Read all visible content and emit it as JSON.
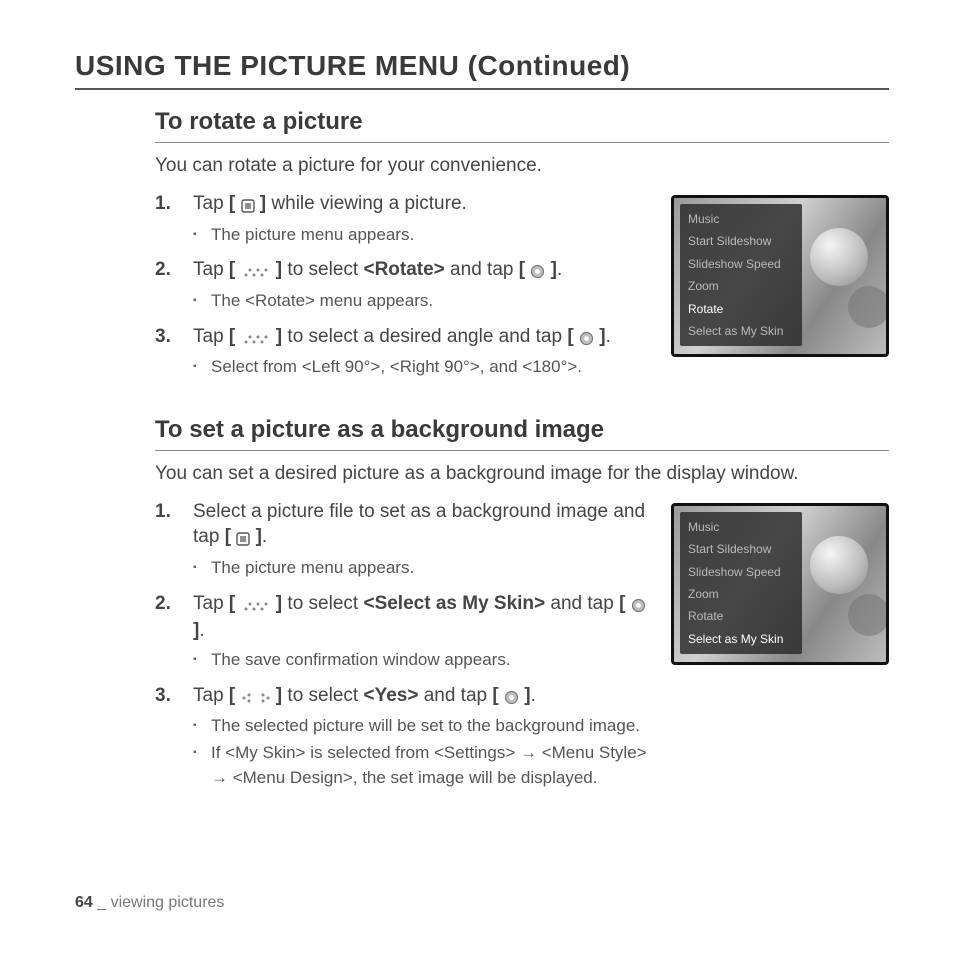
{
  "page": {
    "title": "USING THE PICTURE MENU (Continued)",
    "number": "64",
    "footer_sep": " _ ",
    "footer_label": "viewing pictures"
  },
  "icons": {
    "menu": "≣",
    "updown": "∴ ∵",
    "leftright": "∴  ∵",
    "select": "◉"
  },
  "section1": {
    "heading": "To rotate a picture",
    "intro": "You can rotate a picture for your convenience.",
    "steps": [
      {
        "pre": "Tap [ ",
        "icon": "menu",
        "post": " ] while viewing a picture.",
        "subs": [
          "The picture menu appears."
        ]
      },
      {
        "pre": "Tap [ ",
        "icon": "updown",
        "mid": " ] to select ",
        "bold": "<Rotate>",
        "post2": " and tap [ ",
        "icon2": "select",
        "post3": " ].",
        "subs": [
          "The <Rotate> menu appears."
        ]
      },
      {
        "pre": "Tap [ ",
        "icon": "updown",
        "mid": " ] to select a desired angle and tap [ ",
        "icon2": "select",
        "post3": " ].",
        "subs": [
          "Select from <Left 90°>, <Right 90°>, and <180°>."
        ]
      }
    ],
    "menu": {
      "items": [
        "Music",
        "Start Sildeshow",
        "Slideshow Speed",
        "Zoom",
        "Rotate",
        "Select as My Skin"
      ],
      "selected": 4
    }
  },
  "section2": {
    "heading": "To set a picture as a background image",
    "intro": "You can set a desired picture as a background image for the display window.",
    "steps": [
      {
        "pre": "Select a picture file to set as a background image and tap [ ",
        "icon": "menu",
        "post": " ].",
        "subs": [
          "The picture menu appears."
        ]
      },
      {
        "pre": "Tap [ ",
        "icon": "updown",
        "mid": " ] to select ",
        "bold": "<Select as My Skin>",
        "post2": " and tap [ ",
        "icon2": "select",
        "post3": " ].",
        "subs": [
          "The save confirmation window appears."
        ]
      },
      {
        "pre": "Tap [ ",
        "icon": "leftright",
        "mid": " ] to select ",
        "bold": "<Yes>",
        "post2": " and tap [ ",
        "icon2": "select",
        "post3": " ].",
        "subs": [
          "The selected picture will be set to the background image.",
          "If <My Skin> is selected from <Settings> → <Menu Style> → <Menu Design>, the set image will be displayed."
        ]
      }
    ],
    "menu": {
      "items": [
        "Music",
        "Start Sildeshow",
        "Slideshow Speed",
        "Zoom",
        "Rotate",
        "Select as My Skin"
      ],
      "selected": 5
    }
  }
}
